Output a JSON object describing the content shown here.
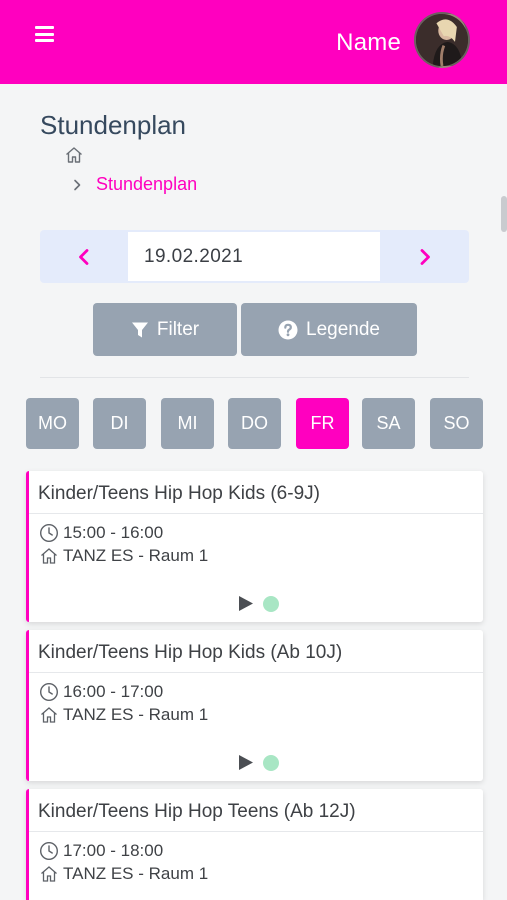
{
  "header": {
    "user_name": "Name",
    "accent_color": "#ff00bf"
  },
  "page": {
    "title": "Stundenplan",
    "breadcrumb": {
      "current": "Stundenplan"
    }
  },
  "date_nav": {
    "date": "19.02.2021"
  },
  "actions": {
    "filter_label": "Filter",
    "legend_label": "Legende"
  },
  "days": [
    {
      "label": "MO",
      "active": false
    },
    {
      "label": "DI",
      "active": false
    },
    {
      "label": "MI",
      "active": false
    },
    {
      "label": "DO",
      "active": false
    },
    {
      "label": "FR",
      "active": true
    },
    {
      "label": "SA",
      "active": false
    },
    {
      "label": "SO",
      "active": false
    }
  ],
  "classes": [
    {
      "title": "Kinder/Teens Hip Hop Kids (6-9J)",
      "time": "15:00 - 16:00",
      "room": "TANZ ES - Raum 1",
      "status_color": "#a8e6c4"
    },
    {
      "title": "Kinder/Teens Hip Hop Kids (Ab 10J)",
      "time": "16:00 - 17:00",
      "room": "TANZ ES - Raum 1",
      "status_color": "#a8e6c4"
    },
    {
      "title": "Kinder/Teens Hip Hop Teens (Ab 12J)",
      "time": "17:00 - 18:00",
      "room": "TANZ ES - Raum 1"
    }
  ]
}
